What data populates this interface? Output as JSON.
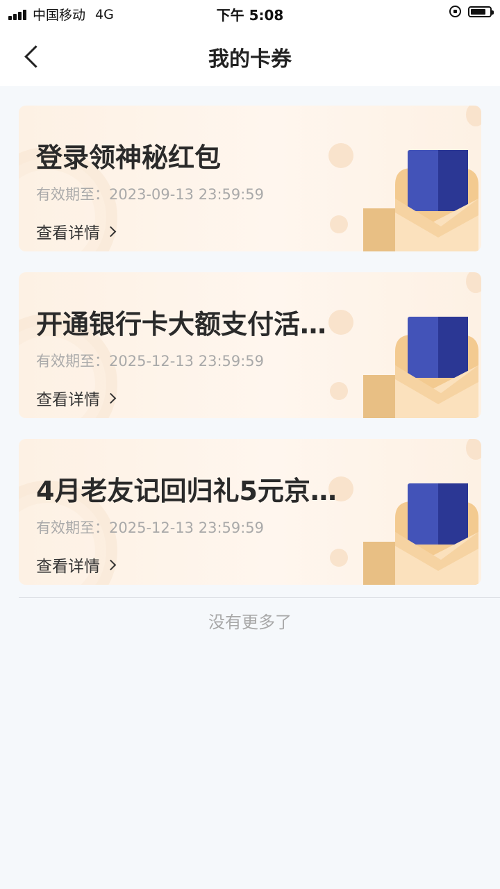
{
  "status_bar": {
    "carrier": "中国移动",
    "network": "4G",
    "time": "下午 5:08",
    "battery_level": 0.8
  },
  "header": {
    "title": "我的卡券",
    "back_icon": "chevron-left-icon"
  },
  "coupons": [
    {
      "title": "登录领神秘红包",
      "expiry_label": "有效期至：",
      "expiry": "2023-09-13 23:59:59",
      "detail_label": "查看详情"
    },
    {
      "title": "开通银行卡大额支付活…",
      "expiry_label": "有效期至：",
      "expiry": "2025-12-13 23:59:59",
      "detail_label": "查看详情"
    },
    {
      "title": "4月老友记回归礼5元京…",
      "expiry_label": "有效期至：",
      "expiry": "2025-12-13 23:59:59",
      "detail_label": "查看详情"
    }
  ],
  "footer": {
    "no_more": "没有更多了"
  },
  "colors": {
    "page_background": "#f5f8fb",
    "card_background": "#fdf1e4",
    "card_blue": "#3f51b5",
    "envelope": "#f0c98f"
  }
}
